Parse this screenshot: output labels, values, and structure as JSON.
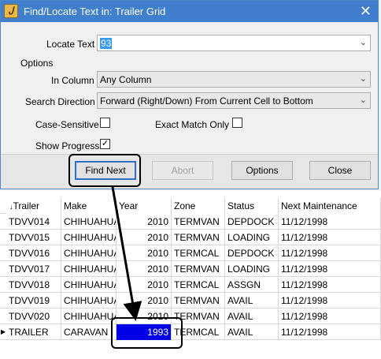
{
  "dialog": {
    "title": "Find/Locate Text in: Trailer Grid",
    "locate_text_label": "Locate Text",
    "locate_text_value": "93",
    "options_group": "Options",
    "in_column_label": "In Column",
    "in_column_value": "Any Column",
    "search_direction_label": "Search Direction",
    "search_direction_value": "Forward (Right/Down) From Current Cell to Bottom",
    "case_sensitive_label": "Case-Sensitive",
    "exact_match_label": "Exact Match Only",
    "show_progress_label": "Show Progress",
    "show_progress_checked": "✓",
    "buttons": {
      "find_next": "Find Next",
      "abort": "Abort",
      "options": "Options",
      "close": "Close"
    }
  },
  "grid": {
    "sort_glyph": "↓",
    "current_row_glyph": "▶",
    "headers": [
      "Trailer",
      "Make",
      "Year",
      "Zone",
      "Status",
      "Next Maintenance"
    ],
    "rows": [
      [
        "TDVV014",
        "CHIHUAHUA",
        "2010",
        "TERMVAN",
        "DEPDOCK",
        "11/12/1998"
      ],
      [
        "TDVV015",
        "CHIHUAHUA",
        "2010",
        "TERMVAN",
        "LOADING",
        "11/12/1998"
      ],
      [
        "TDVV016",
        "CHIHUAHUA",
        "2010",
        "TERMCAL",
        "DEPDOCK",
        "11/12/1998"
      ],
      [
        "TDVV017",
        "CHIHUAHUA",
        "2010",
        "TERMVAN",
        "LOADING",
        "11/12/1998"
      ],
      [
        "TDVV018",
        "CHIHUAHUA",
        "2010",
        "TERMCAL",
        "ASSGN",
        "11/12/1998"
      ],
      [
        "TDVV019",
        "CHIHUAHUA",
        "2010",
        "TERMVAN",
        "AVAIL",
        "11/12/1998"
      ],
      [
        "TDVV020",
        "CHIHUAHUA",
        "2010",
        "TERMVAN",
        "AVAIL",
        "11/12/1998"
      ],
      [
        "TRAILER",
        "CARAVAN",
        "1993",
        "TERMCAL",
        "AVAIL",
        "11/12/1998"
      ]
    ]
  }
}
